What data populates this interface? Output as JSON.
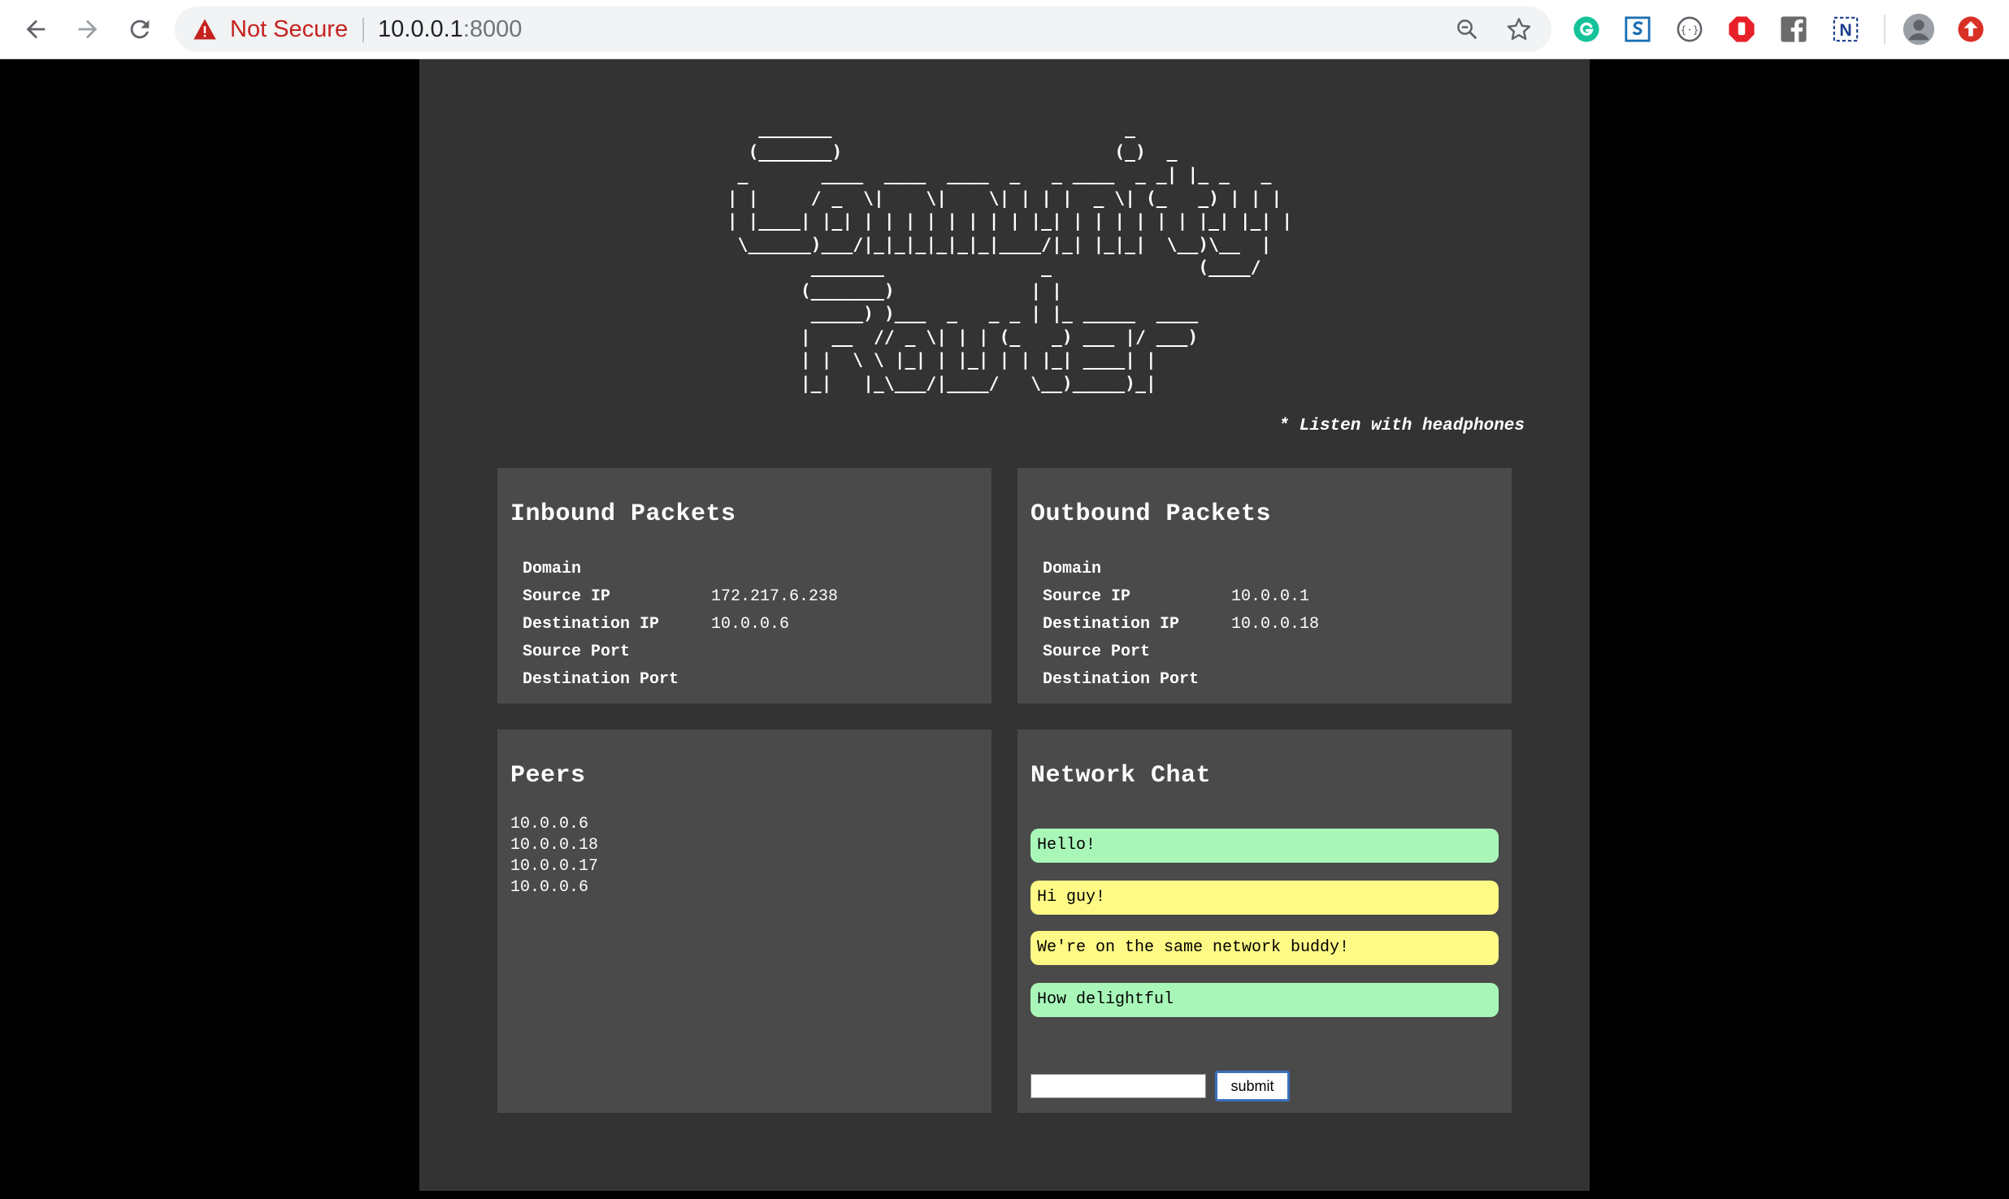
{
  "browser": {
    "security_label": "Not Secure",
    "url_host": "10.0.0.1",
    "url_port": ":8000",
    "icons": [
      "back-arrow-icon",
      "forward-arrow-icon",
      "reload-icon",
      "warning-icon",
      "zoom-icon",
      "star-icon",
      "grammarly-icon",
      "s-extension-icon",
      "code-extension-icon",
      "stop-extension-icon",
      "facebook-icon",
      "n-extension-icon",
      "avatar-icon",
      "update-icon"
    ]
  },
  "header": {
    "ascii_title": "    _______                            _      \n   (_______)                          (_)  _   \n  _       ____  ____  ____  _   _ ____  _ _| |_ _   _\n | |     / _  \\|    \\|    \\| | | |  _ \\| (_   _) | | |\n | |____| |_| | | | | | | | | |_| | | | | | | |_| |_| |\n  \\______)___/|_|_|_|_|_|_|____/|_| |_|_|  \\__)\\__  |\n         _______               _              (____/\n        (_______)             | |\n         _____) )___  _   _ _ | |_ _____  ____\n        |  __  // _ \\| | | (_   _) ___ |/ ___)\n        | |  \\ \\ |_| | |_| | | |_| ____| |\n        |_|   |_\\___/|____/   \\__)_____)_|",
    "tagline": "* Listen with headphones"
  },
  "inbound": {
    "title": "Inbound Packets",
    "rows": [
      {
        "key": "Domain",
        "value": ""
      },
      {
        "key": "Source IP",
        "value": "172.217.6.238"
      },
      {
        "key": "Destination IP",
        "value": "10.0.0.6"
      },
      {
        "key": "Source Port",
        "value": ""
      },
      {
        "key": "Destination Port",
        "value": ""
      }
    ]
  },
  "outbound": {
    "title": "Outbound Packets",
    "rows": [
      {
        "key": "Domain",
        "value": ""
      },
      {
        "key": "Source IP",
        "value": "10.0.0.1"
      },
      {
        "key": "Destination IP",
        "value": "10.0.0.18"
      },
      {
        "key": "Source Port",
        "value": ""
      },
      {
        "key": "Destination Port",
        "value": ""
      }
    ]
  },
  "peers": {
    "title": "Peers",
    "list": [
      "10.0.0.6",
      "10.0.0.18",
      "10.0.0.17",
      "10.0.0.6"
    ]
  },
  "chat": {
    "title": "Network Chat",
    "messages": [
      {
        "text": "Hello!",
        "color": "#a8f7b9"
      },
      {
        "text": "Hi guy!",
        "color": "#fefa85"
      },
      {
        "text": "We're on the same network buddy!",
        "color": "#fefa85"
      },
      {
        "text": "How delightful",
        "color": "#a8f7b9"
      }
    ],
    "input_value": "",
    "submit_label": "submit"
  },
  "colors": {
    "page_bg": "#333333",
    "panel_bg": "#4a4a4a",
    "chat_green": "#a8f7b9",
    "chat_yellow": "#fefa85",
    "warning_red": "#c5221f"
  }
}
